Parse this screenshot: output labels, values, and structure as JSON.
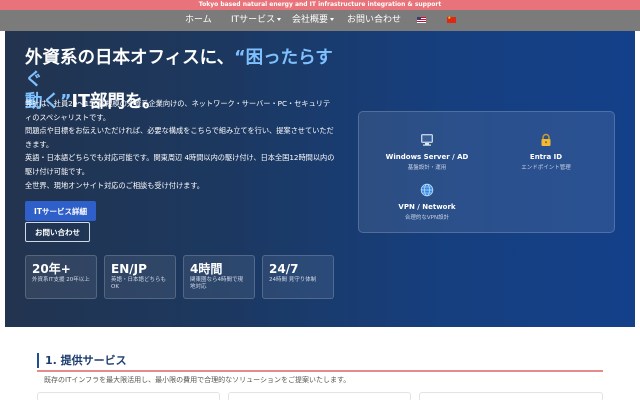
{
  "topbar": {
    "text": "Tokyo based natural energy and IT infrastructure integration & support"
  },
  "nav": {
    "items": [
      {
        "label": "ホーム"
      },
      {
        "label": "ITサービス"
      },
      {
        "label": "会社概要"
      },
      {
        "label": "お問い合わせ"
      }
    ],
    "flags": [
      "us-flag",
      "cn-flag"
    ]
  },
  "hero": {
    "title_line1": "外資系の日本オフィスに、",
    "title_highlight1": "“困ったらすぐ",
    "title_highlight2": "動く”",
    "title_line2_rest": "IT部門を。",
    "desc": [
      "弊社は、社員20〜150名規模の外資系企業向けの、ネットワーク・サーバー・PC・セキュリティのスペシャリストです。",
      "問題点や目標をお伝えいただければ、必要な構成をこちらで組み立てを行い、提案させていただきます。",
      "英語・日本語どちらでも対応可能です。関東周辺 4時間以内の駆け付け、日本全国12時間以内の駆け付け可能です。",
      "全世界、現地オンサイト対応のご相談も受け付けます。"
    ],
    "btn_primary": "ITサービス詳細",
    "btn_secondary": "お問い合わせ",
    "stats": [
      {
        "value": "20年+",
        "desc": "外資系IT支援 20年以上"
      },
      {
        "value": "EN/JP",
        "desc": "英語・日本語どちらもOK"
      },
      {
        "value": "4時間",
        "desc": "関東圏なら4時間で現地対応"
      },
      {
        "value": "24/7",
        "desc": "24時間 見守り体制"
      }
    ],
    "services": [
      {
        "name": "Windows Server / AD",
        "sub": "基盤設計・運用",
        "icon": "server-icon"
      },
      {
        "name": "Entra ID",
        "sub": "エンドポイント管理",
        "icon": "lock-icon"
      },
      {
        "name": "VPN / Network",
        "sub": "合理的なVPN設計",
        "icon": "globe-icon"
      }
    ]
  },
  "section": {
    "title": "1. 提供サービス",
    "subtitle": "既存のITインフラを最大限活用し、最小限の費用で合理的なソリューションをご提案いたします。"
  },
  "colors": {
    "accent": "#2f5fc9",
    "topbar": "#e8737a",
    "nav": "#7b7b7b",
    "highlight": "#7fc1ff"
  }
}
